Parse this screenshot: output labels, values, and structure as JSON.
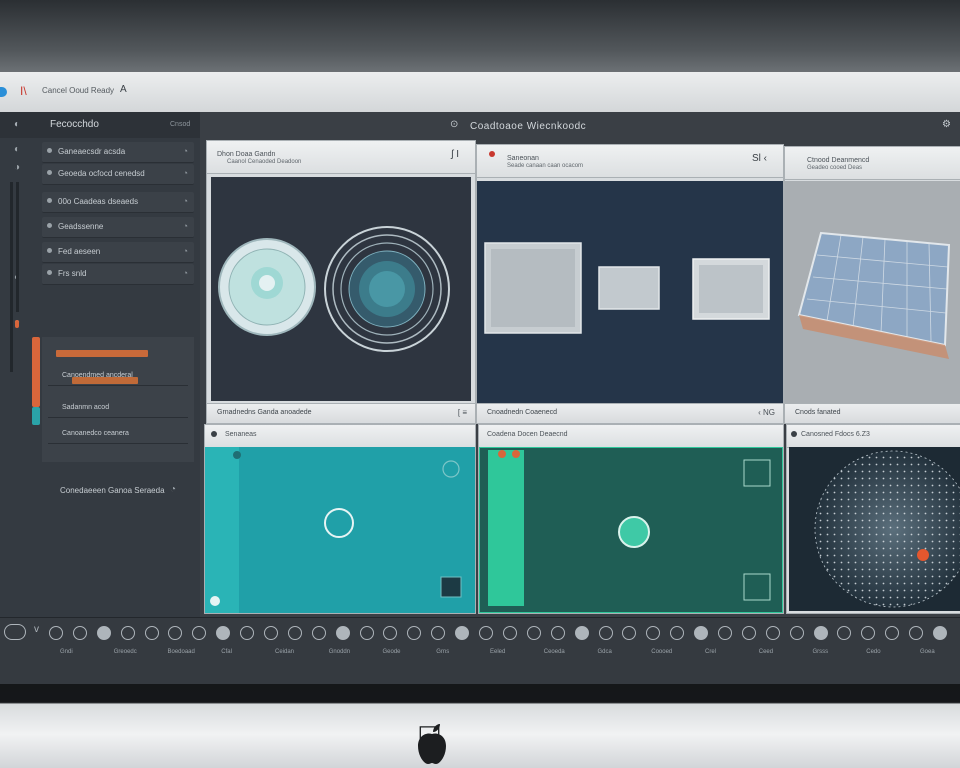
{
  "window": {
    "indicator_char": "I\\",
    "title": "Cancel Ooud Ready",
    "caret": "A"
  },
  "left_panel": {
    "header_icon": "◐",
    "title": "Fecocchdo",
    "header_right": "Cnsod",
    "rows": [
      {
        "label": "Ganeaecsdr acsda"
      },
      {
        "label": "Geoeda ocfocd cenedsd"
      },
      {
        "label": "00o  Caadeas dseaeds"
      },
      {
        "label": "Geadssenne"
      },
      {
        "label": "Fed aeseen"
      },
      {
        "label": "Frs snld"
      }
    ],
    "sub_rows": [
      {
        "label": ""
      },
      {
        "label": "Canoendmed ancderal"
      },
      {
        "label": "Sadanmn acod"
      },
      {
        "label": "Canoanedco ceanera"
      }
    ],
    "footer": "Conedaeeen Ganoa Seraeda"
  },
  "topbar": {
    "icon": "⊙",
    "title": "Coadtoaoe  Wiecnkoodc",
    "gear": "⚙"
  },
  "panels": [
    {
      "title": "Dhon  Doaa Gandn",
      "subtitle": "Caanol  Cenaoded Deadoon",
      "icon": "ʃ I",
      "footer": "Grnadnedns Ganda anoadede",
      "footer_icon": "[ ≡"
    },
    {
      "title": "Saneonan",
      "subtitle": "Seade canaan  caan ocacom",
      "icon": "Sl  ‹",
      "footer": "Cnoadnedn Coaenecd",
      "footer_icon": "‹ NG"
    },
    {
      "title": "Ctnood Deanmencd",
      "subtitle": "Geadeo cooed Deas",
      "icon": "",
      "footer": "Cnods fanated",
      "footer_icon": ""
    },
    {
      "title": "Senaneas",
      "subtitle": "",
      "icon": "",
      "footer": "",
      "footer_icon": ""
    },
    {
      "title": "Coadena Docen Deaecnd",
      "subtitle": "",
      "icon": "",
      "footer": "",
      "footer_icon": ""
    },
    {
      "title": "Canosned Fdocs 6.Z3",
      "subtitle": "",
      "icon": "",
      "footer": "",
      "footer_icon": ""
    }
  ],
  "toolbar_items": [
    "Gndi",
    "Greoedc",
    "Boedoaad",
    "Cfal",
    "Ceidan",
    "Gnoddn",
    "Geode",
    "Grns",
    "Eeled",
    "Ceoeda",
    "Gdca",
    "Coooed",
    "Crel",
    "Ceed",
    "Grsss",
    "Cedo",
    "Goea"
  ],
  "colors": {
    "accent_teal": "#20a0a8",
    "accent_green": "#2fc79a",
    "accent_orange": "#d8663b",
    "dark_panel": "#2e3540",
    "navy_panel": "#253549"
  }
}
